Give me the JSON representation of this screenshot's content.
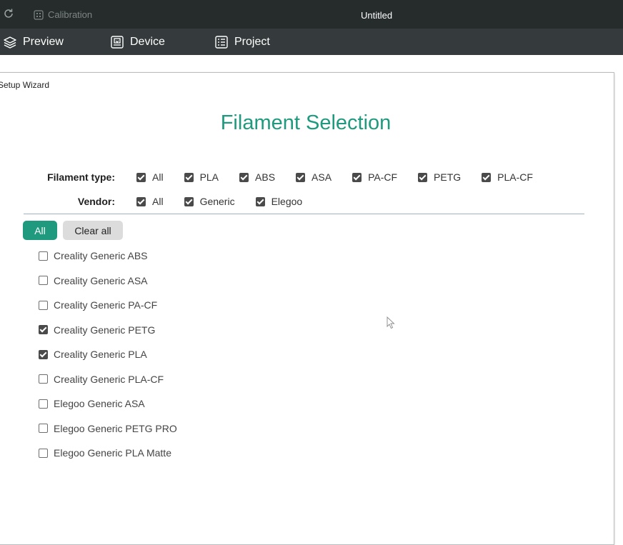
{
  "titlebar": {
    "calibration_label": "Calibration",
    "document_title": "Untitled"
  },
  "nav": {
    "items": [
      {
        "label": "Preview",
        "icon": "layers-icon"
      },
      {
        "label": "Device",
        "icon": "device-icon"
      },
      {
        "label": "Project",
        "icon": "project-icon"
      }
    ]
  },
  "wizard": {
    "window_title": "Setup Wizard",
    "heading": "Filament Selection",
    "filament_type": {
      "label": "Filament type:",
      "options": [
        {
          "label": "All",
          "checked": true
        },
        {
          "label": "PLA",
          "checked": true
        },
        {
          "label": "ABS",
          "checked": true
        },
        {
          "label": "ASA",
          "checked": true
        },
        {
          "label": "PA-CF",
          "checked": true
        },
        {
          "label": "PETG",
          "checked": true
        },
        {
          "label": "PLA-CF",
          "checked": true
        }
      ]
    },
    "vendor": {
      "label": "Vendor:",
      "options": [
        {
          "label": "All",
          "checked": true
        },
        {
          "label": "Generic",
          "checked": true
        },
        {
          "label": "Elegoo",
          "checked": true
        }
      ]
    },
    "buttons": {
      "all_label": "All",
      "clear_all_label": "Clear all"
    },
    "filaments": [
      {
        "label": "Creality Generic ABS",
        "checked": false
      },
      {
        "label": "Creality Generic ASA",
        "checked": false
      },
      {
        "label": "Creality Generic PA-CF",
        "checked": false
      },
      {
        "label": "Creality Generic PETG",
        "checked": true
      },
      {
        "label": "Creality Generic PLA",
        "checked": true
      },
      {
        "label": "Creality Generic PLA-CF",
        "checked": false
      },
      {
        "label": "Elegoo Generic ASA",
        "checked": false
      },
      {
        "label": "Elegoo Generic PETG PRO",
        "checked": false
      },
      {
        "label": "Elegoo Generic PLA Matte",
        "checked": false
      }
    ],
    "colors": {
      "accent": "#1f9a7e",
      "titlebar": "#262b2c",
      "navbar": "#353b3c"
    }
  }
}
